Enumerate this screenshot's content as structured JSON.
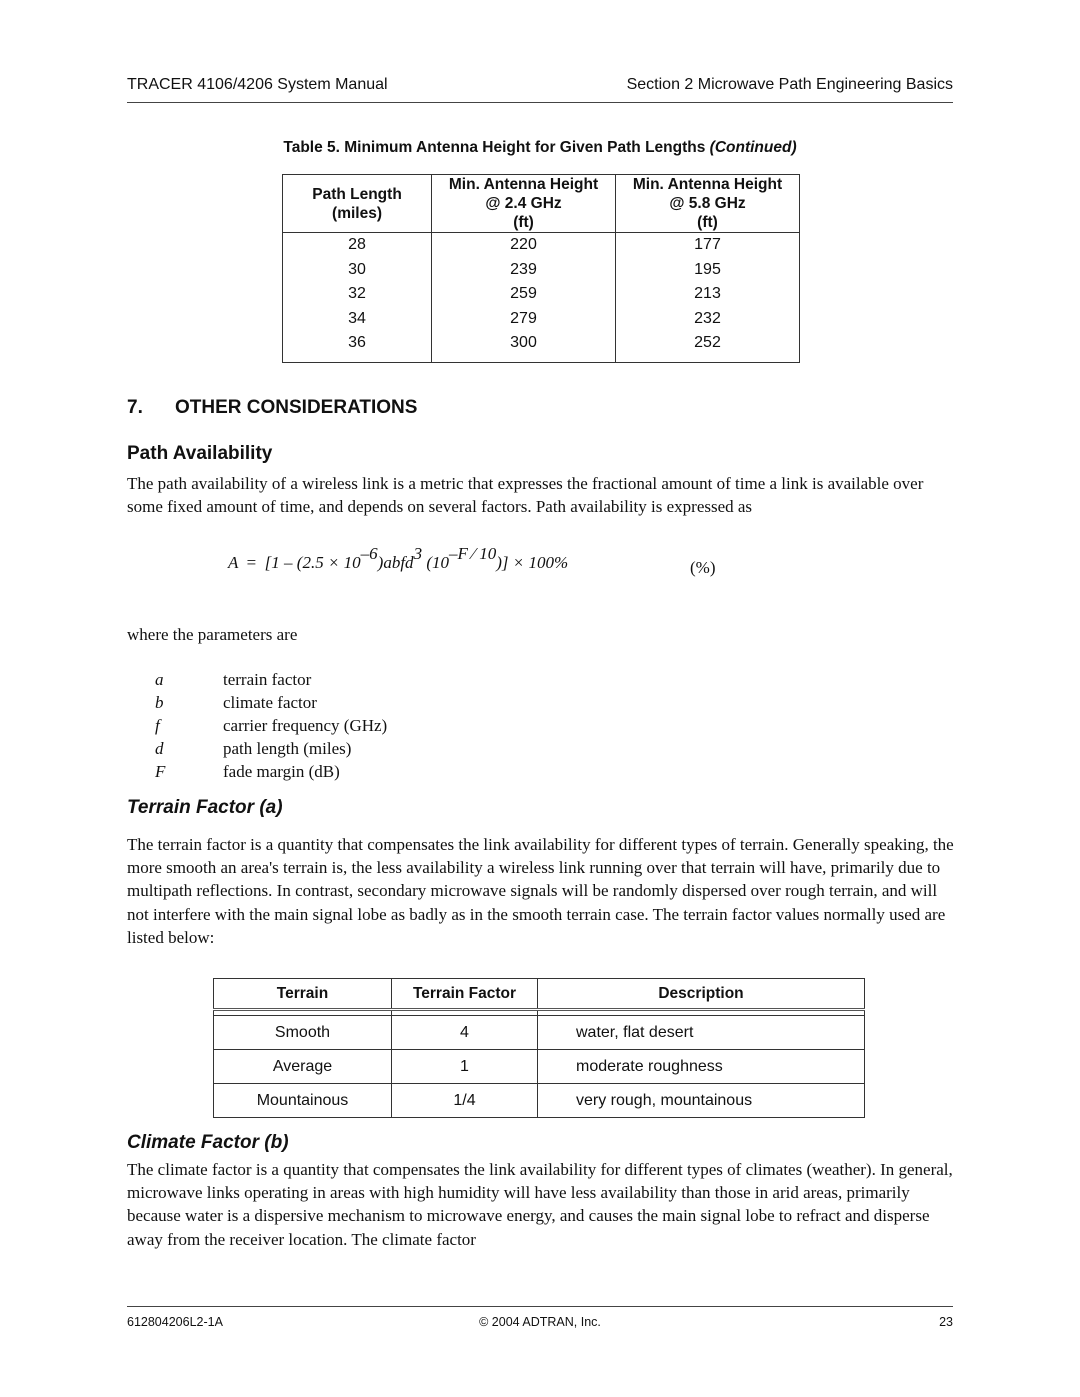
{
  "header": {
    "left": "TRACER 4106/4206 System Manual",
    "right": "Section 2  Microwave Path Engineering Basics"
  },
  "table5": {
    "caption_main": "Table 5.   Minimum Antenna Height for Given Path Lengths ",
    "caption_suffix": "(Continued)",
    "headers": [
      [
        "Path Length",
        "(miles)"
      ],
      [
        "Min. Antenna Height",
        "@ 2.4 GHz",
        "(ft)"
      ],
      [
        "Min. Antenna Height",
        "@ 5.8 GHz",
        "(ft)"
      ]
    ],
    "rows": [
      [
        "28",
        "220",
        "177"
      ],
      [
        "30",
        "239",
        "195"
      ],
      [
        "32",
        "259",
        "213"
      ],
      [
        "34",
        "279",
        "232"
      ],
      [
        "36",
        "300",
        "252"
      ]
    ]
  },
  "section": {
    "number": "7.",
    "title": "OTHER CONSIDERATIONS"
  },
  "path_availability": {
    "heading": "Path Availability",
    "intro": "The path availability of a wireless link is a metric that expresses the fractional amount of time a link is available over some fixed amount of time, and depends on several factors. Path availability is expressed as",
    "formula": {
      "lhs": "A",
      "eq": "=",
      "part1": "[1 – (2.5 × 10",
      "exp1": "–6",
      "part2": ")abfd",
      "exp2": "3",
      "part3": "(10",
      "exp3": "–F ⁄ 10",
      "part4": ")] × 100%",
      "tag": "(%)"
    },
    "params_intro": "where the parameters are",
    "params": [
      {
        "symbol": "a",
        "desc": "terrain factor"
      },
      {
        "symbol": "b",
        "desc": "climate factor"
      },
      {
        "symbol": "f",
        "desc": "carrier frequency (GHz)"
      },
      {
        "symbol": "d",
        "desc": "path length (miles)"
      },
      {
        "symbol": "F",
        "desc": "fade margin (dB)"
      }
    ]
  },
  "terrain_factor": {
    "heading": "Terrain Factor (a)",
    "body": "The terrain factor is a quantity that compensates the link availability for different types of terrain. Generally speaking, the more smooth an area's terrain is, the less availability a wireless link running over that terrain will have, primarily due to multipath reflections. In contrast, secondary microwave signals will be randomly dispersed over rough terrain, and will not interfere with the main signal lobe as badly as in the smooth terrain case. The terrain factor values normally used are listed below:",
    "table": {
      "headers": [
        "Terrain",
        "Terrain Factor",
        "Description"
      ],
      "rows": [
        [
          "Smooth",
          "4",
          "water, flat desert"
        ],
        [
          "Average",
          "1",
          "moderate roughness"
        ],
        [
          "Mountainous",
          "1/4",
          "very rough, mountainous"
        ]
      ]
    }
  },
  "climate_factor": {
    "heading": "Climate Factor (b)",
    "body": "The climate factor is a quantity that compensates the link availability for different types of climates (weather). In general, microwave links operating in areas with high humidity will have less availability than those in arid areas, primarily because water is a dispersive mechanism to microwave energy, and causes the main signal lobe to refract and disperse away from the receiver location. The climate factor"
  },
  "footer": {
    "left": "612804206L2-1A",
    "center": "© 2004 ADTRAN, Inc.",
    "right": "23"
  }
}
